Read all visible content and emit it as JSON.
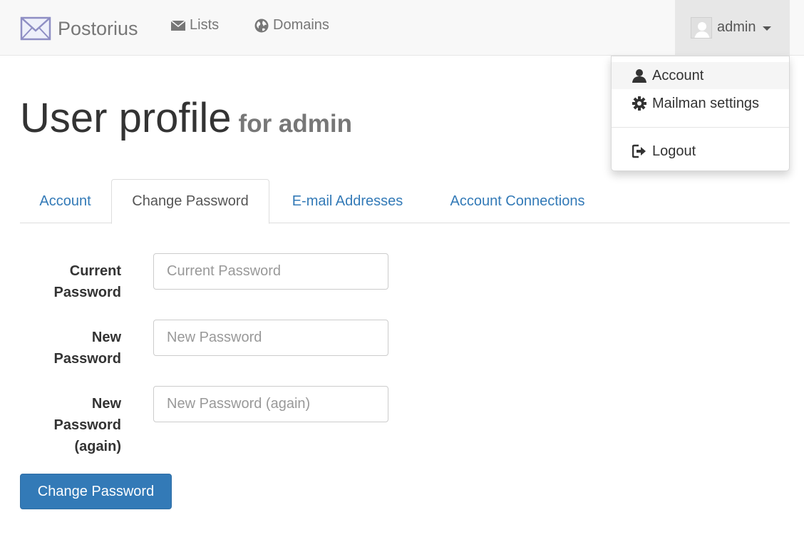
{
  "navbar": {
    "brand": "Postorius",
    "brand_icon": "envelope-logo-icon",
    "links": [
      {
        "label": "Lists",
        "icon": "envelope-icon"
      },
      {
        "label": "Domains",
        "icon": "globe-icon"
      }
    ],
    "user": {
      "name": "admin",
      "avatar": "avatar-placeholder"
    }
  },
  "user_menu": {
    "items": [
      {
        "label": "Account",
        "icon": "user-icon"
      },
      {
        "label": "Mailman settings",
        "icon": "gear-icon"
      },
      {
        "label": "Logout",
        "icon": "logout-icon"
      }
    ]
  },
  "page": {
    "title": "User profile",
    "subtitle": "for admin"
  },
  "tabs": [
    {
      "label": "Account",
      "active": false
    },
    {
      "label": "Change Password",
      "active": true
    },
    {
      "label": "E-mail Addresses",
      "active": false
    },
    {
      "label": "Account Connections",
      "active": false
    }
  ],
  "form": {
    "current": {
      "label_line1": "Current",
      "label_line2": "Password",
      "placeholder": "Current Password",
      "value": ""
    },
    "new": {
      "label_line1": "New",
      "label_line2": "Password",
      "placeholder": "New Password",
      "value": ""
    },
    "again": {
      "label_line1": "New",
      "label_line2": "Password",
      "label_line3": "(again)",
      "placeholder": "New Password (again)",
      "value": ""
    },
    "submit_label": "Change Password"
  },
  "colors": {
    "link": "#337ab7",
    "primary_button": "#337ab7",
    "navbar_bg": "#f8f8f8"
  }
}
